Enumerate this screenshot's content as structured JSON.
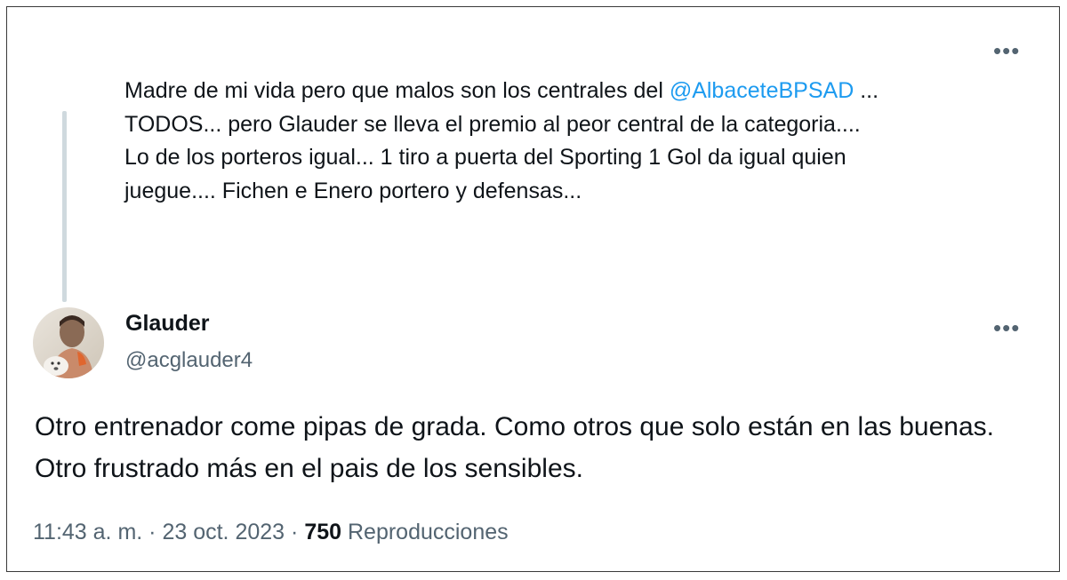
{
  "quoted_tweet": {
    "text_before_mention": "Madre de mi vida pero que malos son los centrales del ",
    "mention": "@AlbaceteBPSAD",
    "text_after_mention": " ...\nTODOS... pero Glauder se lleva el premio al peor central de la categoria....\nLo de los porteros igual... 1 tiro a puerta del Sporting 1 Gol da igual quien\njuegue.... Fichen e Enero portero y defensas...",
    "more_icon": "more-horizontal-icon"
  },
  "reply_tweet": {
    "display_name": "Glauder",
    "handle": "@acglauder4",
    "body": "Otro entrenador come pipas de grada. Como otros que solo están en las buenas. Otro frustrado más en el pais de los sensibles.",
    "time": "11:43 a. m.",
    "date": "23 oct. 2023",
    "separator": "·",
    "views_count": "750",
    "views_label": "Reproducciones",
    "more_icon": "more-horizontal-icon"
  },
  "colors": {
    "text": "#0f1419",
    "secondary": "#536471",
    "link": "#1d9bf0",
    "thread_line": "#cfd9de"
  }
}
